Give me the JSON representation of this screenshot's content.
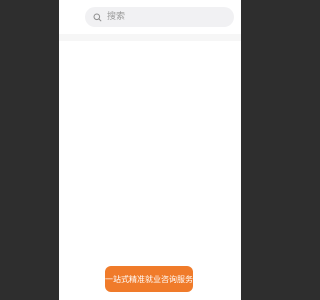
{
  "search": {
    "placeholder": "搜索",
    "icon": "search-icon"
  },
  "cta": {
    "label": "一站式精准就业咨询服务",
    "color": "#f07b2a"
  },
  "colors": {
    "backdrop": "#2e2e2e",
    "page": "#ffffff",
    "search_bg": "#f1f1f3"
  }
}
